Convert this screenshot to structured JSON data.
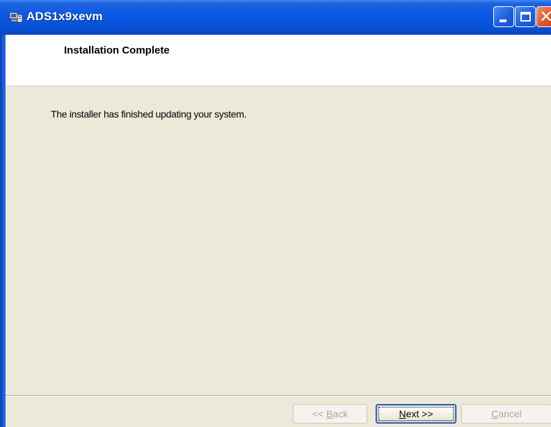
{
  "window": {
    "title": "ADS1x9xevm"
  },
  "banner": {
    "title": "Installation Complete"
  },
  "main": {
    "message": "The installer has finished updating your system."
  },
  "buttons": {
    "back": {
      "prefix": "<< ",
      "mnemonic": "B",
      "rest": "ack",
      "enabled": false
    },
    "next": {
      "mnemonic": "N",
      "rest": "ext >>",
      "enabled": true,
      "focused": true
    },
    "cancel": {
      "label": "Cancel",
      "enabled": false
    }
  },
  "colors": {
    "titlebar": "#0a58e6",
    "body": "#ece9d8",
    "banner": "#ffffff",
    "close_button": "#e2552b"
  },
  "icons": {
    "app": "installer-computer-icon",
    "minimize": "minimize-icon",
    "maximize": "maximize-icon",
    "close": "close-icon"
  }
}
